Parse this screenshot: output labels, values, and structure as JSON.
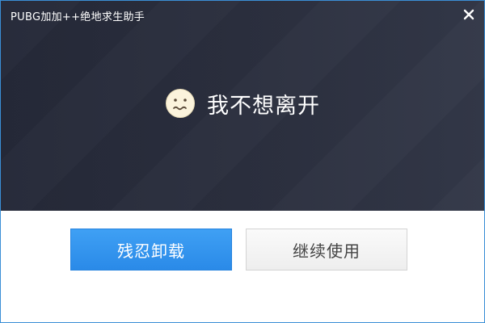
{
  "window": {
    "title": "PUBG加加++绝地求生助手"
  },
  "hero": {
    "message": "我不想离开",
    "icon": "sad-face-icon"
  },
  "actions": {
    "uninstall_label": "残忍卸载",
    "continue_label": "继续使用"
  },
  "colors": {
    "accent": "#2a8ae8",
    "hero_bg": "#2a2e3d",
    "window_border": "#3b8fd6"
  }
}
